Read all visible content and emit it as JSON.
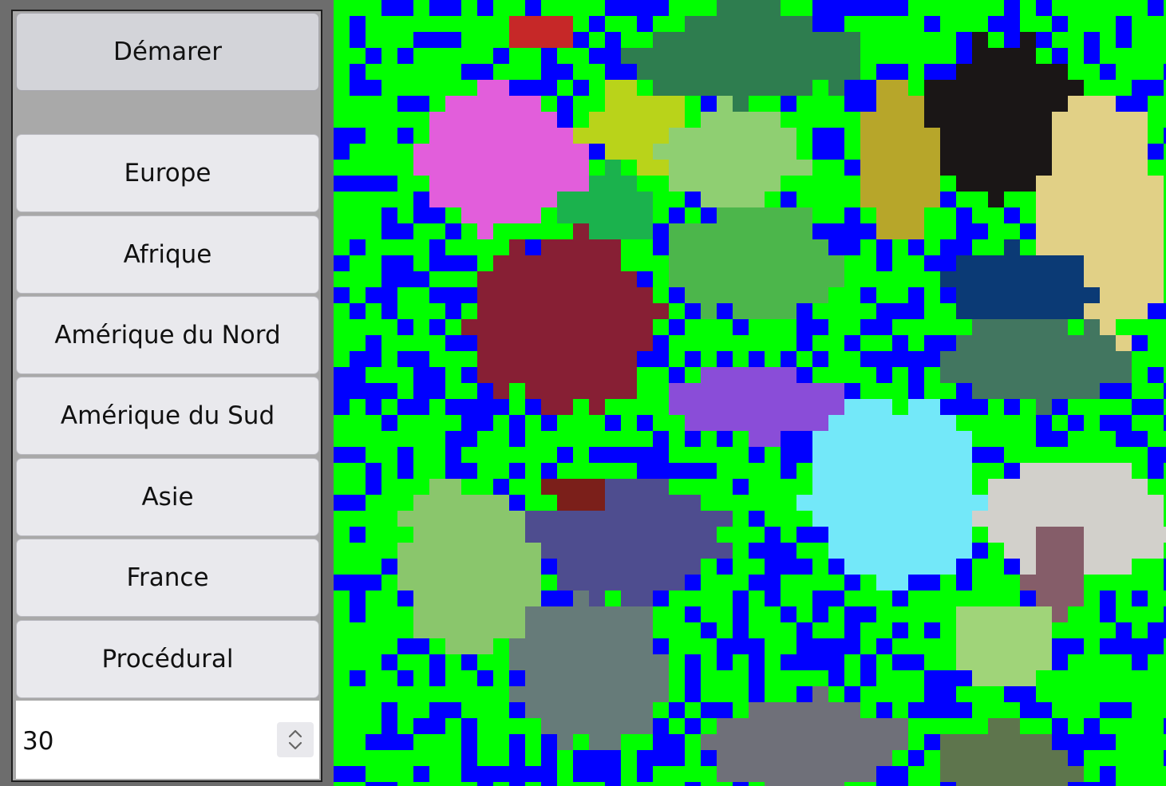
{
  "controls": {
    "start_label": "Démarer",
    "maps": [
      {
        "label": "Europe"
      },
      {
        "label": "Afrique"
      },
      {
        "label": "Amérique du Nord"
      },
      {
        "label": "Amérique du Sud"
      },
      {
        "label": "Asie"
      },
      {
        "label": "France"
      },
      {
        "label": "Procédural"
      }
    ],
    "seed_value": "30",
    "spinner_icon": "up-down-arrows-icon"
  },
  "colors": {
    "sea": "#0000ff",
    "land": "#00ff00",
    "regions": [
      "#c62828",
      "#2e7d4f",
      "#e25edb",
      "#b9d31a",
      "#8fcf72",
      "#b7a62a",
      "#1a1616",
      "#e1d086",
      "#1bb24d",
      "#4cb64b",
      "#871f34",
      "#0b3a75",
      "#427660",
      "#8a4dd8",
      "#73e8f9",
      "#d2d0cb",
      "#8ac66c",
      "#4e4d8f",
      "#7b1f1a",
      "#855d69",
      "#a0d479",
      "#667b79",
      "#6f7079",
      "#5e754d"
    ]
  }
}
